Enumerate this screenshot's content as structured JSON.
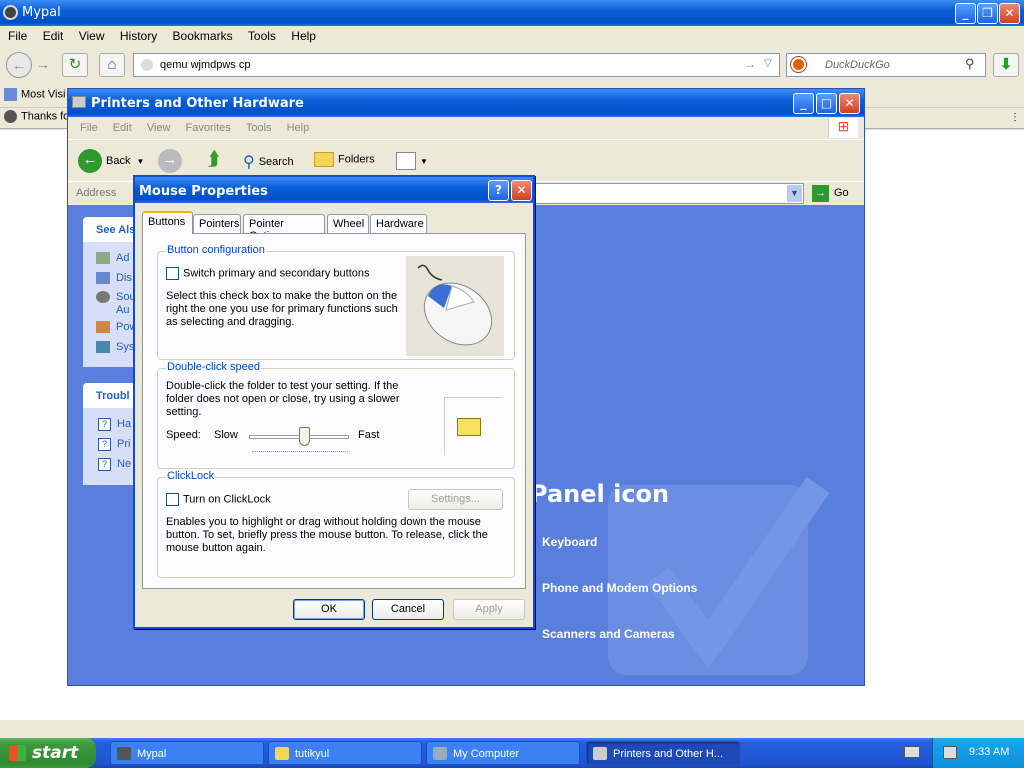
{
  "browser": {
    "title": "Mypal",
    "menu": [
      "File",
      "Edit",
      "View",
      "History",
      "Bookmarks",
      "Tools",
      "Help"
    ],
    "url": "qemu wjmdpws cp",
    "search_placeholder": "DuckDuckGo",
    "bookmarks": [
      "Most Visi",
      "Thanks fo"
    ]
  },
  "explorer": {
    "title": "Printers and Other Hardware",
    "menu": [
      "File",
      "Edit",
      "View",
      "Favorites",
      "Tools",
      "Help"
    ],
    "toolbar": {
      "back": "Back",
      "search": "Search",
      "folders": "Folders"
    },
    "address_label": "Address",
    "go": "Go",
    "see_also": {
      "title": "See Als",
      "items": [
        "Ad",
        "Dis",
        "Sou",
        "Au",
        "Pow",
        "Sys"
      ]
    },
    "trouble": {
      "title": "Troubl",
      "items": [
        "Ha",
        "Pri",
        "Ne"
      ]
    },
    "panel_heading": "Panel icon",
    "panel_items": [
      "Keyboard",
      "Phone and Modem Options",
      "Scanners and Cameras"
    ]
  },
  "dialog": {
    "title": "Mouse Properties",
    "help": "?",
    "tabs": [
      "Buttons",
      "Pointers",
      "Pointer Options",
      "Wheel",
      "Hardware"
    ],
    "button_config": {
      "legend": "Button configuration",
      "checkbox": "Switch primary and secondary buttons",
      "desc": "Select this check box to make the button on the right the one you use for primary functions such as selecting and dragging."
    },
    "dblclick": {
      "legend": "Double-click speed",
      "desc": "Double-click the folder to test your setting. If the folder does not open or close, try using a slower setting.",
      "speed": "Speed:",
      "slow": "Slow",
      "fast": "Fast",
      "level": 0.55
    },
    "clicklock": {
      "legend": "ClickLock",
      "checkbox": "Turn on ClickLock",
      "settings": "Settings...",
      "desc": "Enables you to highlight or drag without holding down the mouse button. To set, briefly press the mouse button. To release, click the mouse button again."
    },
    "ok": "OK",
    "cancel": "Cancel",
    "apply": "Apply"
  },
  "taskbar": {
    "start": "start",
    "tasks": [
      "Mypal",
      "tutikyul",
      "My Computer",
      "Printers and Other H..."
    ],
    "time": "9:33 AM"
  },
  "colors": {
    "xp_blue": "#0a5fd8",
    "start_green": "#3c9a3c",
    "panel_bg": "#5a7edc"
  }
}
